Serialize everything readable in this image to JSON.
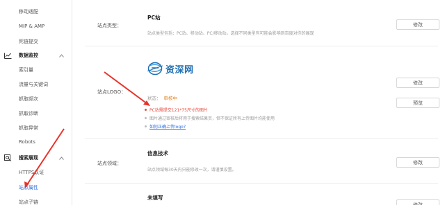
{
  "sidebar": {
    "items_top": [
      {
        "label": "移动适配"
      },
      {
        "label": "MIP & AMP"
      },
      {
        "label": "死链提交"
      }
    ],
    "group_monitor": {
      "label": "数据监控"
    },
    "monitor_items": [
      {
        "label": "索引量"
      },
      {
        "label": "流量与关键词"
      },
      {
        "label": "抓取频次"
      },
      {
        "label": "抓取诊断"
      },
      {
        "label": "抓取异常"
      },
      {
        "label": "Robots"
      }
    ],
    "group_display": {
      "label": "搜索展现"
    },
    "display_items": [
      {
        "label": "HTTPS认证"
      },
      {
        "label": "站点属性"
      },
      {
        "label": "站点子链"
      }
    ]
  },
  "rows": {
    "type": {
      "label": "站点类型：",
      "title": "PC站",
      "desc": "站点类型包括：PC站、移动站、PC/移动站，选择不同类型有可能会影响到百度对你的展现",
      "button": "修改"
    },
    "logo": {
      "label": "站点LOGO：",
      "logo_text": "资深网",
      "status_label": "状态：",
      "status_value": "审核中",
      "button_edit": "修改",
      "button_preview": "预览",
      "bullet_1": "PC站需提交121*75尺寸的图片",
      "bullet_2": "图片通过审核后将用于搜索结果页，但不保证所有上传图片均能使用",
      "bullet_3": "如何正确上传logo?"
    },
    "domain": {
      "label": "站点领域：",
      "title": "信息技术",
      "desc": "站点领域每30天内只能修改一次，请谨慎设置。",
      "button": "修改"
    },
    "last": {
      "title": "未填写",
      "button": "修改"
    }
  },
  "colors": {
    "accent": "#2b6de0",
    "warning": "#e84a3b",
    "pending": "#e08a2a",
    "logo_blue": "#1f6fb5"
  }
}
